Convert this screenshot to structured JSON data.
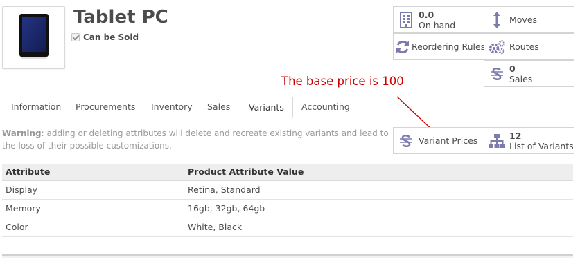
{
  "product": {
    "name": "Tablet PC",
    "can_be_sold_label": "Can be Sold",
    "can_be_sold": true
  },
  "smart_buttons": {
    "on_hand": {
      "value": "0.0",
      "label": "On hand",
      "icon": "building-icon"
    },
    "moves": {
      "label": "Moves",
      "icon": "vertical-arrows-icon"
    },
    "reordering_rules": {
      "label": "Reordering Rules",
      "icon": "refresh-icon"
    },
    "routes": {
      "label": "Routes",
      "icon": "gears-icon"
    },
    "sales": {
      "value": "0",
      "label": "Sales",
      "icon": "dollar-icon"
    },
    "variant_prices": {
      "label": "Variant Prices",
      "icon": "dollar-icon"
    },
    "list_of_variants": {
      "value": "12",
      "label": "List of Variants",
      "icon": "sitemap-icon"
    }
  },
  "annotation": "The base price is 100",
  "tabs": [
    "Information",
    "Procurements",
    "Inventory",
    "Sales",
    "Variants",
    "Accounting"
  ],
  "active_tab": "Variants",
  "warning": {
    "title": "Warning",
    "text": ": adding or deleting attributes will delete and recreate existing variants and lead to the loss of their possible customizations."
  },
  "attributes_table": {
    "headers": [
      "Attribute",
      "Product Attribute Value"
    ],
    "rows": [
      [
        "Display",
        "Retina, Standard"
      ],
      [
        "Memory",
        "16gb, 32gb, 64gb"
      ],
      [
        "Color",
        "White, Black"
      ]
    ]
  },
  "colors": {
    "icon": "#7c7bad",
    "annotation": "#cc0000"
  }
}
